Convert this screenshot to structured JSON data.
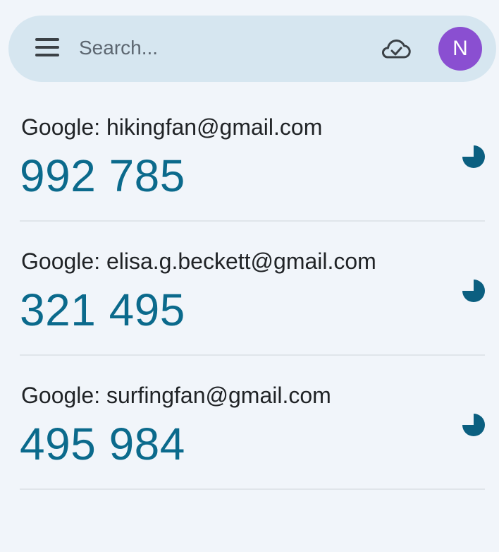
{
  "search": {
    "placeholder": "Search..."
  },
  "header": {
    "avatar_initial": "N",
    "avatar_color": "#8a4fd1",
    "sync_icon": "cloud-check-icon",
    "menu_icon": "hamburger-menu-icon"
  },
  "accounts": [
    {
      "label": "Google: hikingfan@gmail.com",
      "code": "992 785"
    },
    {
      "label": "Google: elisa.g.beckett@gmail.com",
      "code": "321 495"
    },
    {
      "label": "Google: surfingfan@gmail.com",
      "code": "495 984"
    }
  ],
  "colors": {
    "code": "#0b6a8c",
    "timer": "#0b5f80",
    "search_bar": "#d6e6f0",
    "background": "#f1f5fa"
  }
}
